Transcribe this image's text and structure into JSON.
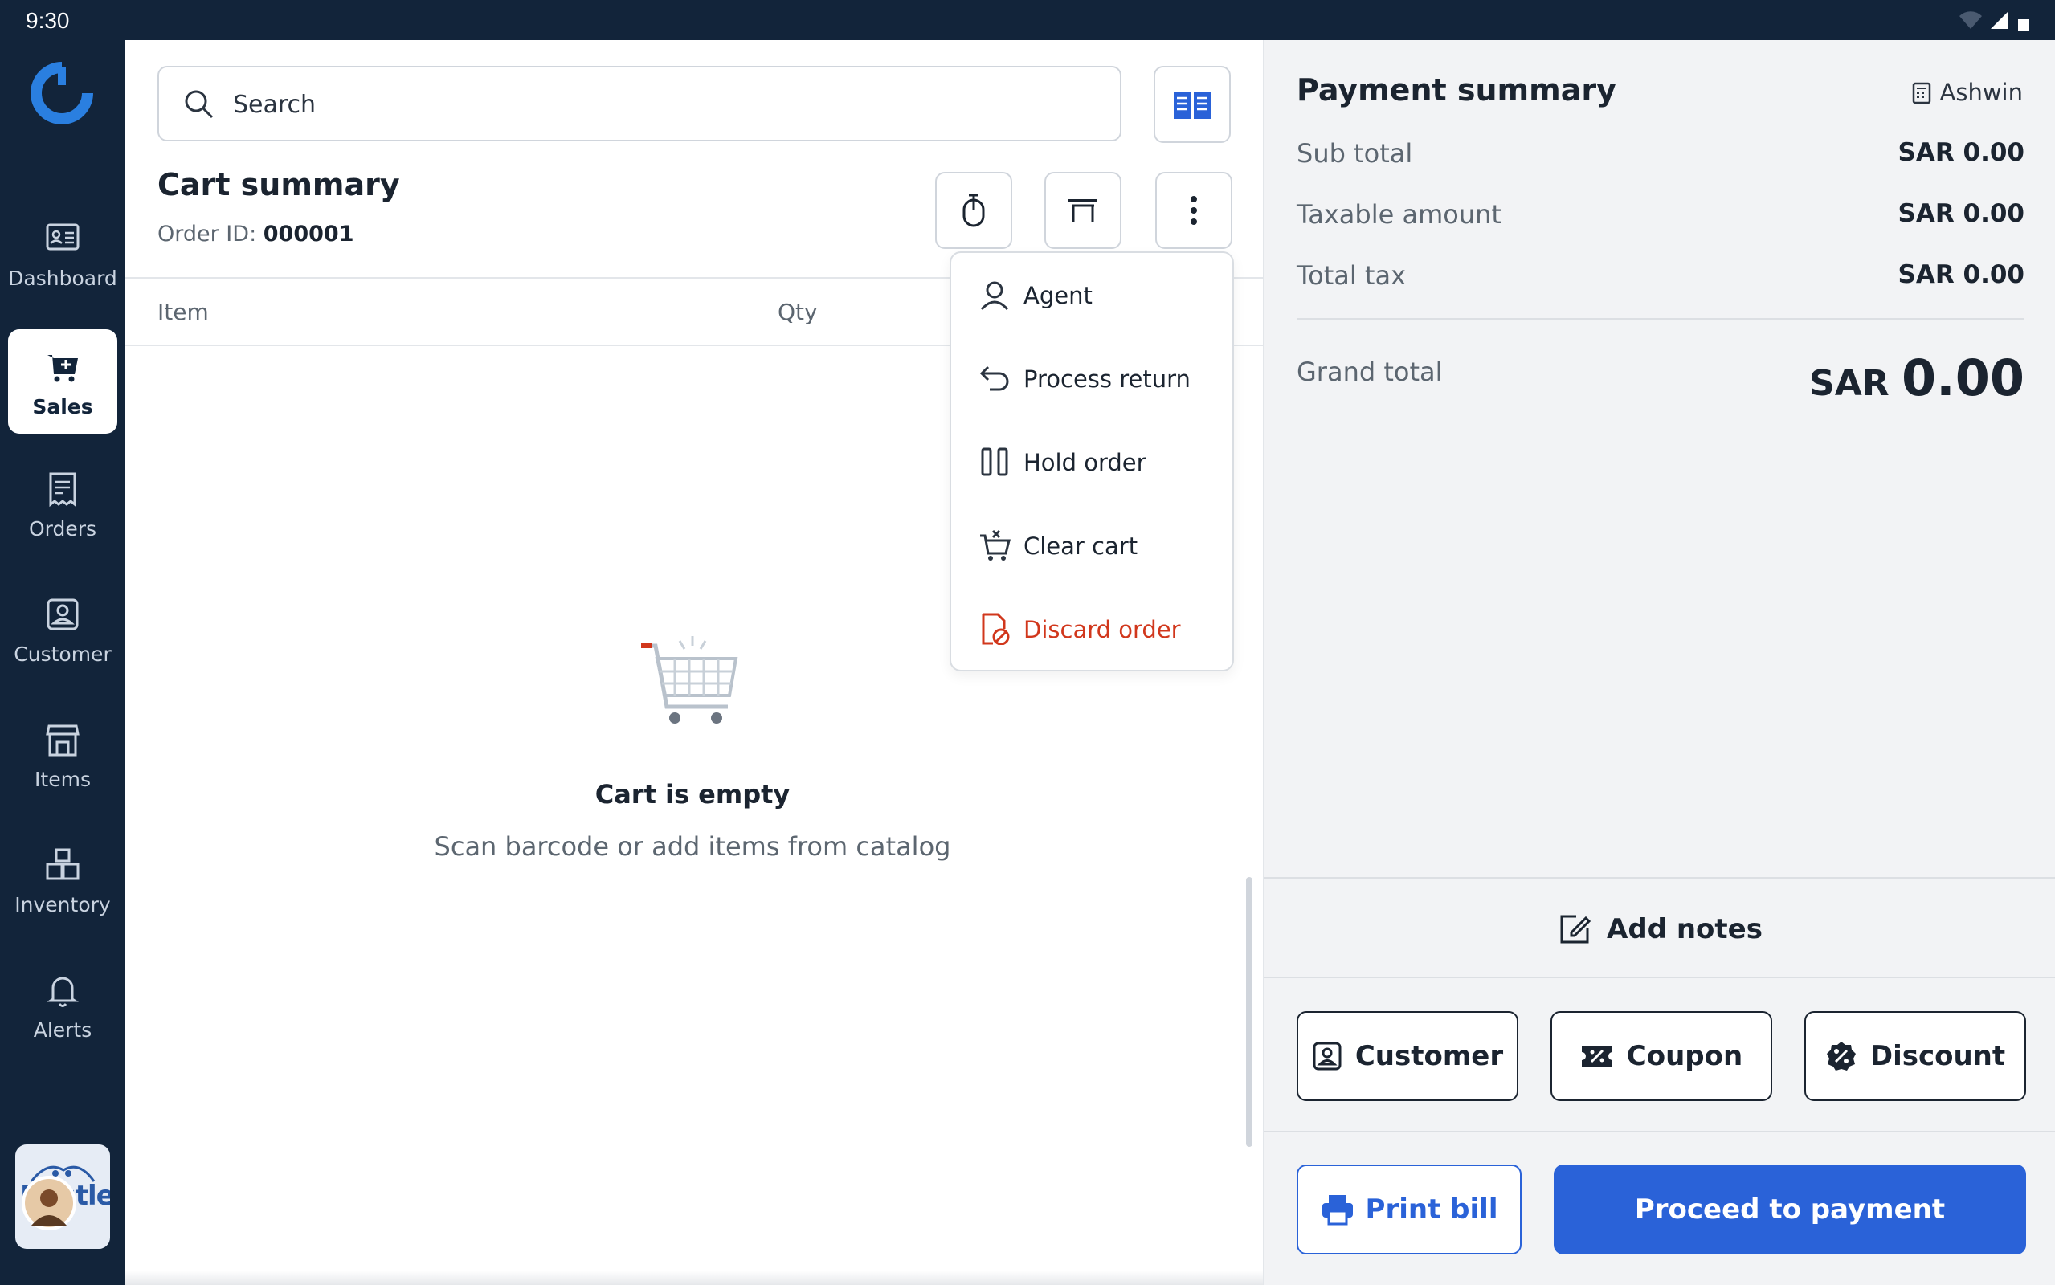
{
  "status_bar": {
    "time": "9:30"
  },
  "sidebar": {
    "items": [
      {
        "label": "Dashboard",
        "icon": "dashboard-icon"
      },
      {
        "label": "Sales",
        "icon": "cart-plus-icon",
        "active": true
      },
      {
        "label": "Orders",
        "icon": "receipt-icon"
      },
      {
        "label": "Customer",
        "icon": "customer-icon"
      },
      {
        "label": "Items",
        "icon": "store-icon"
      },
      {
        "label": "Inventory",
        "icon": "boxes-icon"
      },
      {
        "label": "Alerts",
        "icon": "bell-icon"
      }
    ],
    "brand": "Nestle"
  },
  "search": {
    "placeholder": "Search"
  },
  "cart": {
    "title": "Cart summary",
    "order_id_label": "Order ID:",
    "order_id": "000001",
    "columns": {
      "item": "Item",
      "qty": "Qty"
    },
    "empty_title": "Cart is empty",
    "empty_subtitle": "Scan barcode or add items from catalog"
  },
  "menu": {
    "items": [
      {
        "label": "Agent",
        "icon": "agent-icon"
      },
      {
        "label": "Process return",
        "icon": "return-icon"
      },
      {
        "label": "Hold order",
        "icon": "pause-icon"
      },
      {
        "label": "Clear cart",
        "icon": "clear-cart-icon"
      },
      {
        "label": "Discard order",
        "icon": "discard-icon",
        "danger": true
      }
    ]
  },
  "payment": {
    "title": "Payment summary",
    "user": "Ashwin",
    "rows": [
      {
        "label": "Sub total",
        "value": "SAR 0.00"
      },
      {
        "label": "Taxable amount",
        "value": "SAR 0.00"
      },
      {
        "label": "Total tax",
        "value": "SAR 0.00"
      }
    ],
    "grand_total_label": "Grand total",
    "grand_total_currency": "SAR",
    "grand_total_value": "0.00",
    "add_notes": "Add notes",
    "buttons": {
      "customer": "Customer",
      "coupon": "Coupon",
      "discount": "Discount"
    },
    "print_bill": "Print bill",
    "proceed": "Proceed to payment"
  },
  "colors": {
    "accent": "#2a62d8",
    "sidebar_bg": "#12243a",
    "danger": "#d1371c",
    "panel_bg": "#f2f3f5"
  }
}
